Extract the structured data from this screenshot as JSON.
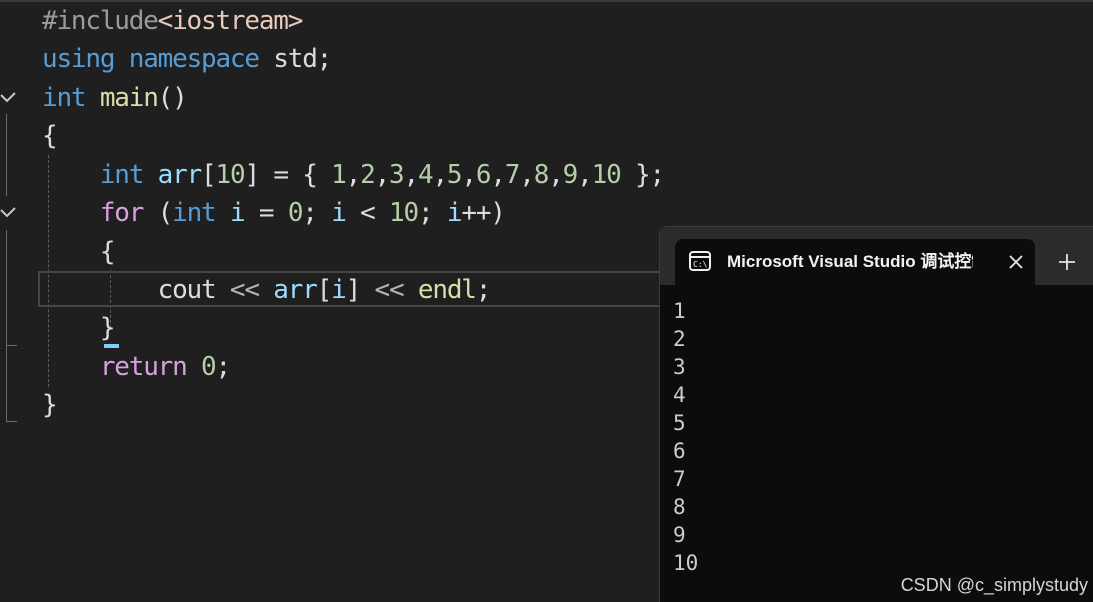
{
  "editor": {
    "lines": [
      {
        "tokens": [
          {
            "t": "#include",
            "c": "inc"
          },
          {
            "t": "<iostream>",
            "c": "str"
          }
        ]
      },
      {
        "tokens": [
          {
            "t": "using",
            "c": "kw"
          },
          {
            "t": " "
          },
          {
            "t": "namespace",
            "c": "kw"
          },
          {
            "t": " std;"
          }
        ]
      },
      {
        "tokens": [
          {
            "t": "int",
            "c": "kw"
          },
          {
            "t": " "
          },
          {
            "t": "main",
            "c": "fn"
          },
          {
            "t": "()"
          }
        ]
      },
      {
        "tokens": [
          {
            "t": "{"
          }
        ]
      },
      {
        "tokens": [
          {
            "t": "    "
          },
          {
            "t": "int",
            "c": "kw"
          },
          {
            "t": " "
          },
          {
            "t": "arr",
            "c": "var"
          },
          {
            "t": "["
          },
          {
            "t": "10",
            "c": "num"
          },
          {
            "t": "] = { "
          },
          {
            "t": "1",
            "c": "num"
          },
          {
            "t": ","
          },
          {
            "t": "2",
            "c": "num"
          },
          {
            "t": ","
          },
          {
            "t": "3",
            "c": "num"
          },
          {
            "t": ","
          },
          {
            "t": "4",
            "c": "num"
          },
          {
            "t": ","
          },
          {
            "t": "5",
            "c": "num"
          },
          {
            "t": ","
          },
          {
            "t": "6",
            "c": "num"
          },
          {
            "t": ","
          },
          {
            "t": "7",
            "c": "num"
          },
          {
            "t": ","
          },
          {
            "t": "8",
            "c": "num"
          },
          {
            "t": ","
          },
          {
            "t": "9",
            "c": "num"
          },
          {
            "t": ","
          },
          {
            "t": "10",
            "c": "num"
          },
          {
            "t": " };"
          }
        ]
      },
      {
        "tokens": [
          {
            "t": "    "
          },
          {
            "t": "for",
            "c": "ctl"
          },
          {
            "t": " ("
          },
          {
            "t": "int",
            "c": "kw"
          },
          {
            "t": " "
          },
          {
            "t": "i",
            "c": "var"
          },
          {
            "t": " = "
          },
          {
            "t": "0",
            "c": "num"
          },
          {
            "t": "; "
          },
          {
            "t": "i",
            "c": "var"
          },
          {
            "t": " < "
          },
          {
            "t": "10",
            "c": "num"
          },
          {
            "t": "; "
          },
          {
            "t": "i",
            "c": "var"
          },
          {
            "t": "++)"
          }
        ]
      },
      {
        "tokens": [
          {
            "t": "    {"
          }
        ]
      },
      {
        "tokens": [
          {
            "t": "        cout "
          },
          {
            "t": "<<",
            "c": "op"
          },
          {
            "t": " "
          },
          {
            "t": "arr",
            "c": "var"
          },
          {
            "t": "["
          },
          {
            "t": "i",
            "c": "var"
          },
          {
            "t": "] "
          },
          {
            "t": "<<",
            "c": "op"
          },
          {
            "t": " "
          },
          {
            "t": "endl",
            "c": "fn"
          },
          {
            "t": ";"
          }
        ]
      },
      {
        "tokens": [
          {
            "t": "    }"
          }
        ]
      },
      {
        "tokens": [
          {
            "t": "    "
          },
          {
            "t": "return",
            "c": "ctl"
          },
          {
            "t": " "
          },
          {
            "t": "0",
            "c": "num"
          },
          {
            "t": ";"
          }
        ]
      },
      {
        "tokens": [
          {
            "t": "}"
          }
        ]
      }
    ]
  },
  "console": {
    "tab_title": "Microsoft Visual Studio 调试控制台",
    "tab_icon": "console-window-icon",
    "close_icon": "close-icon",
    "new_tab_icon": "plus-icon",
    "output": [
      "1",
      "2",
      "3",
      "4",
      "5",
      "6",
      "7",
      "8",
      "9",
      "10"
    ]
  },
  "watermark": "CSDN @c_simplystudy"
}
